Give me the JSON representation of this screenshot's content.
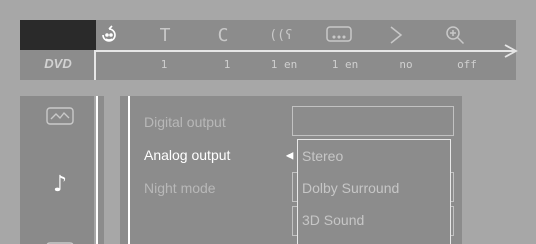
{
  "status_bar": {
    "disc_badge": "DVD",
    "icons": [
      {
        "name": "title-icon",
        "glyph": "T"
      },
      {
        "name": "chapter-icon",
        "glyph": "C"
      },
      {
        "name": "audio-icon",
        "glyph": "((ʕ"
      },
      {
        "name": "subtitle-icon",
        "glyph": "…"
      },
      {
        "name": "angle-icon",
        "glyph": "◇"
      },
      {
        "name": "zoom-icon",
        "glyph": "⊕"
      }
    ],
    "values": [
      "1",
      "1",
      "1 en",
      "1 en",
      "no",
      "off"
    ]
  },
  "sidebar": {
    "items": [
      {
        "name": "picture-settings-icon"
      },
      {
        "name": "audio-settings-icon",
        "glyph": "♪"
      },
      {
        "name": "language-settings-icon"
      }
    ]
  },
  "audio_menu": {
    "rows": [
      {
        "label": "Digital output"
      },
      {
        "label": "Analog output"
      },
      {
        "label": "Night mode"
      }
    ],
    "dropdown_options": [
      "Stereo",
      "Dolby Surround",
      "3D Sound"
    ]
  },
  "colors": {
    "background": "#a7a7a7",
    "panel": "#8c8c8c",
    "active_text": "#ffffff",
    "inactive_text": "#b8b8b8"
  }
}
